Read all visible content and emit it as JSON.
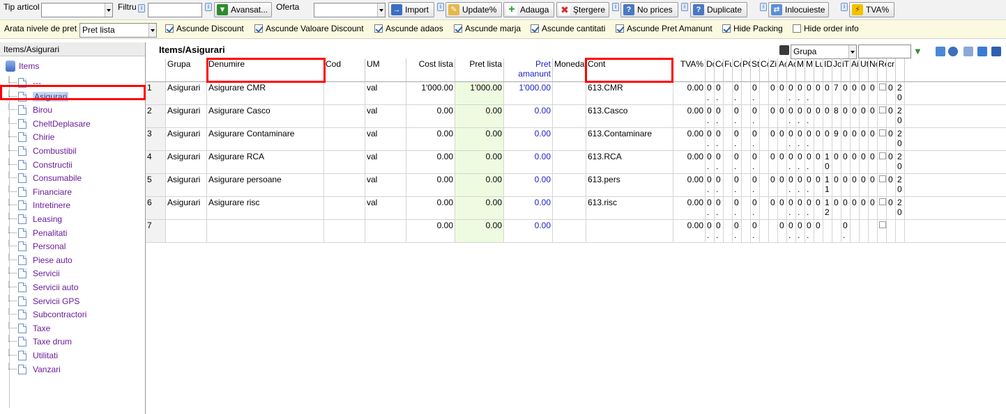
{
  "toolbar": {
    "tip_articol_label": "Tip articol",
    "filtru_label": "Filtru",
    "avansat_label": "Avansat...",
    "oferta_label": "Oferta",
    "import_label": "Import",
    "update_label": "Update%",
    "adauga_label": "Adauga",
    "stergere_label": "Ştergere",
    "no_prices_label": "No prices",
    "duplicate_label": "Duplicate",
    "inlocuieste_label": "Inlocuieste",
    "tva_label": "TVA%",
    "tip_articol_value": "",
    "filtru_value": "",
    "oferta_value": ""
  },
  "options": {
    "arata_nivele_label": "Arata nivele de pret",
    "pret_select_value": "Pret lista",
    "checkboxes": [
      {
        "label": "Ascunde Discount",
        "checked": true
      },
      {
        "label": "Ascunde Valoare Discount",
        "checked": true
      },
      {
        "label": "Ascunde adaos",
        "checked": true
      },
      {
        "label": "Ascunde marja",
        "checked": true
      },
      {
        "label": "Ascunde cantitati",
        "checked": true
      },
      {
        "label": "Ascunde Pret Amanunt",
        "checked": true
      },
      {
        "label": "Hide Packing",
        "checked": true
      },
      {
        "label": "Hide order info",
        "checked": false
      }
    ]
  },
  "tree": {
    "header": "Items/Asigurari",
    "root": "Items",
    "items": [
      "---",
      "Asigurari",
      "Birou",
      "CheltDeplasare",
      "Chirie",
      "Combustibil",
      "Constructii",
      "Consumabile",
      "Financiare",
      "Intretinere",
      "Leasing",
      "Penalitati",
      "Personal",
      "Piese auto",
      "Servicii",
      "Servicii auto",
      "Servicii GPS",
      "Subcontractori",
      "Taxe",
      "Taxe drum",
      "Utilitati",
      "Vanzari"
    ],
    "selected": "Asigurari"
  },
  "grid": {
    "title": "Items/Asigurari",
    "group_select": "Grupa",
    "search_value": "",
    "headers": {
      "grupa": "Grupa",
      "denumire": "Denumire",
      "cod": "Cod",
      "um": "UM",
      "cost_lista": "Cost lista",
      "pret_lista": "Pret lista",
      "pret_amanunt": "Pret amanunt",
      "moneda": "Moneda",
      "cont": "Cont",
      "tva": "TVA%"
    },
    "tiny_headers": [
      "Dc lo",
      "Cc m",
      "Fu",
      "Cc m",
      "PC",
      "St fu",
      "Cc fu",
      "Zi liv",
      "Ac Au",
      "Ac %",
      "M (R",
      "M (B",
      "Lu ga",
      "ID",
      "Jc",
      "iT",
      "Ai fil",
      "Ut",
      "Nc ite",
      "Re",
      "cr"
    ],
    "rows": [
      {
        "n": "1",
        "grupa": "Asigurari",
        "denumire": "Asigurare CMR",
        "cod": "",
        "um": "val",
        "cost": "1'000.00",
        "pret": "1'000.00",
        "amanunt": "1'000.00",
        "moneda": "",
        "cont": "613.CMR",
        "tva": "0.00",
        "tiny": [
          "0 .",
          "0 .",
          "",
          "0 .",
          "",
          "0 .",
          "",
          "0",
          "0",
          "0 .",
          "0 .",
          "0 .",
          "0",
          "0",
          "7",
          "0",
          "0",
          "0",
          "0",
          "",
          "0",
          "2 0"
        ]
      },
      {
        "n": "2",
        "grupa": "Asigurari",
        "denumire": "Asigurare Casco",
        "cod": "",
        "um": "val",
        "cost": "0.00",
        "pret": "0.00",
        "amanunt": "0.00",
        "moneda": "",
        "cont": "613.Casco",
        "tva": "0.00",
        "tiny": [
          "0 .",
          "0 .",
          "",
          "0 .",
          "",
          "0 .",
          "",
          "0",
          "0",
          "0 .",
          "0 .",
          "0 .",
          "0",
          "0",
          "8",
          "0",
          "0",
          "0",
          "0",
          "",
          "0",
          "2 0"
        ]
      },
      {
        "n": "3",
        "grupa": "Asigurari",
        "denumire": "Asigurare Contaminare",
        "cod": "",
        "um": "val",
        "cost": "0.00",
        "pret": "0.00",
        "amanunt": "0.00",
        "moneda": "",
        "cont": "613.Contaminare",
        "tva": "0.00",
        "tiny": [
          "0 .",
          "0 .",
          "",
          "0 .",
          "",
          "0 .",
          "",
          "0",
          "0",
          "0 .",
          "0 .",
          "0 .",
          "0",
          "0",
          "9",
          "0",
          "0",
          "0",
          "0",
          "",
          "0",
          "2 0"
        ]
      },
      {
        "n": "4",
        "grupa": "Asigurari",
        "denumire": "Asigurare RCA",
        "cod": "",
        "um": "val",
        "cost": "0.00",
        "pret": "0.00",
        "amanunt": "0.00",
        "moneda": "",
        "cont": "613.RCA",
        "tva": "0.00",
        "tiny": [
          "0 .",
          "0 .",
          "",
          "0 .",
          "",
          "0 .",
          "",
          "0",
          "0",
          "0 .",
          "0 .",
          "0 .",
          "0",
          "1 0",
          "0",
          "0",
          "0",
          "0",
          "0",
          "",
          "0",
          "2 0"
        ]
      },
      {
        "n": "5",
        "grupa": "Asigurari",
        "denumire": "Asigurare persoane",
        "cod": "",
        "um": "val",
        "cost": "0.00",
        "pret": "0.00",
        "amanunt": "0.00",
        "moneda": "",
        "cont": "613.pers",
        "tva": "0.00",
        "tiny": [
          "0 .",
          "0 .",
          "",
          "0 .",
          "",
          "0 .",
          "",
          "0",
          "0",
          "0 .",
          "0 .",
          "0 .",
          "0",
          "1 1",
          "0",
          "0",
          "0",
          "0",
          "0",
          "",
          "0",
          "2 0"
        ]
      },
      {
        "n": "6",
        "grupa": "Asigurari",
        "denumire": "Asigurare risc",
        "cod": "",
        "um": "val",
        "cost": "0.00",
        "pret": "0.00",
        "amanunt": "0.00",
        "moneda": "",
        "cont": "613.risc",
        "tva": "0.00",
        "tiny": [
          "0 .",
          "0 .",
          "",
          "0 .",
          "",
          "0 .",
          "",
          "0",
          "0",
          "0 .",
          "0 .",
          "0 .",
          "0",
          "1 2",
          "0",
          "0",
          "0",
          "0",
          "0",
          "",
          "0",
          "2 0"
        ]
      },
      {
        "n": "7",
        "grupa": "",
        "denumire": "",
        "cod": "",
        "um": "",
        "cost": "0.00",
        "pret": "0.00",
        "amanunt": "0.00",
        "moneda": "",
        "cont": "",
        "tva": "0.00",
        "tiny": [
          "0 .",
          "0 .",
          "",
          "0 .",
          "",
          "0 .",
          "",
          "",
          "0",
          "0 .",
          "0 .",
          "0 .",
          "0",
          "",
          "",
          "0 .",
          "",
          "",
          "",
          "",
          "",
          ""
        ]
      }
    ]
  },
  "colors": {
    "accent_purple": "#6a1b9a",
    "blue_text": "#1a22c7",
    "highlight_red": "#ff0000",
    "green_cell": "#eefbe0"
  }
}
